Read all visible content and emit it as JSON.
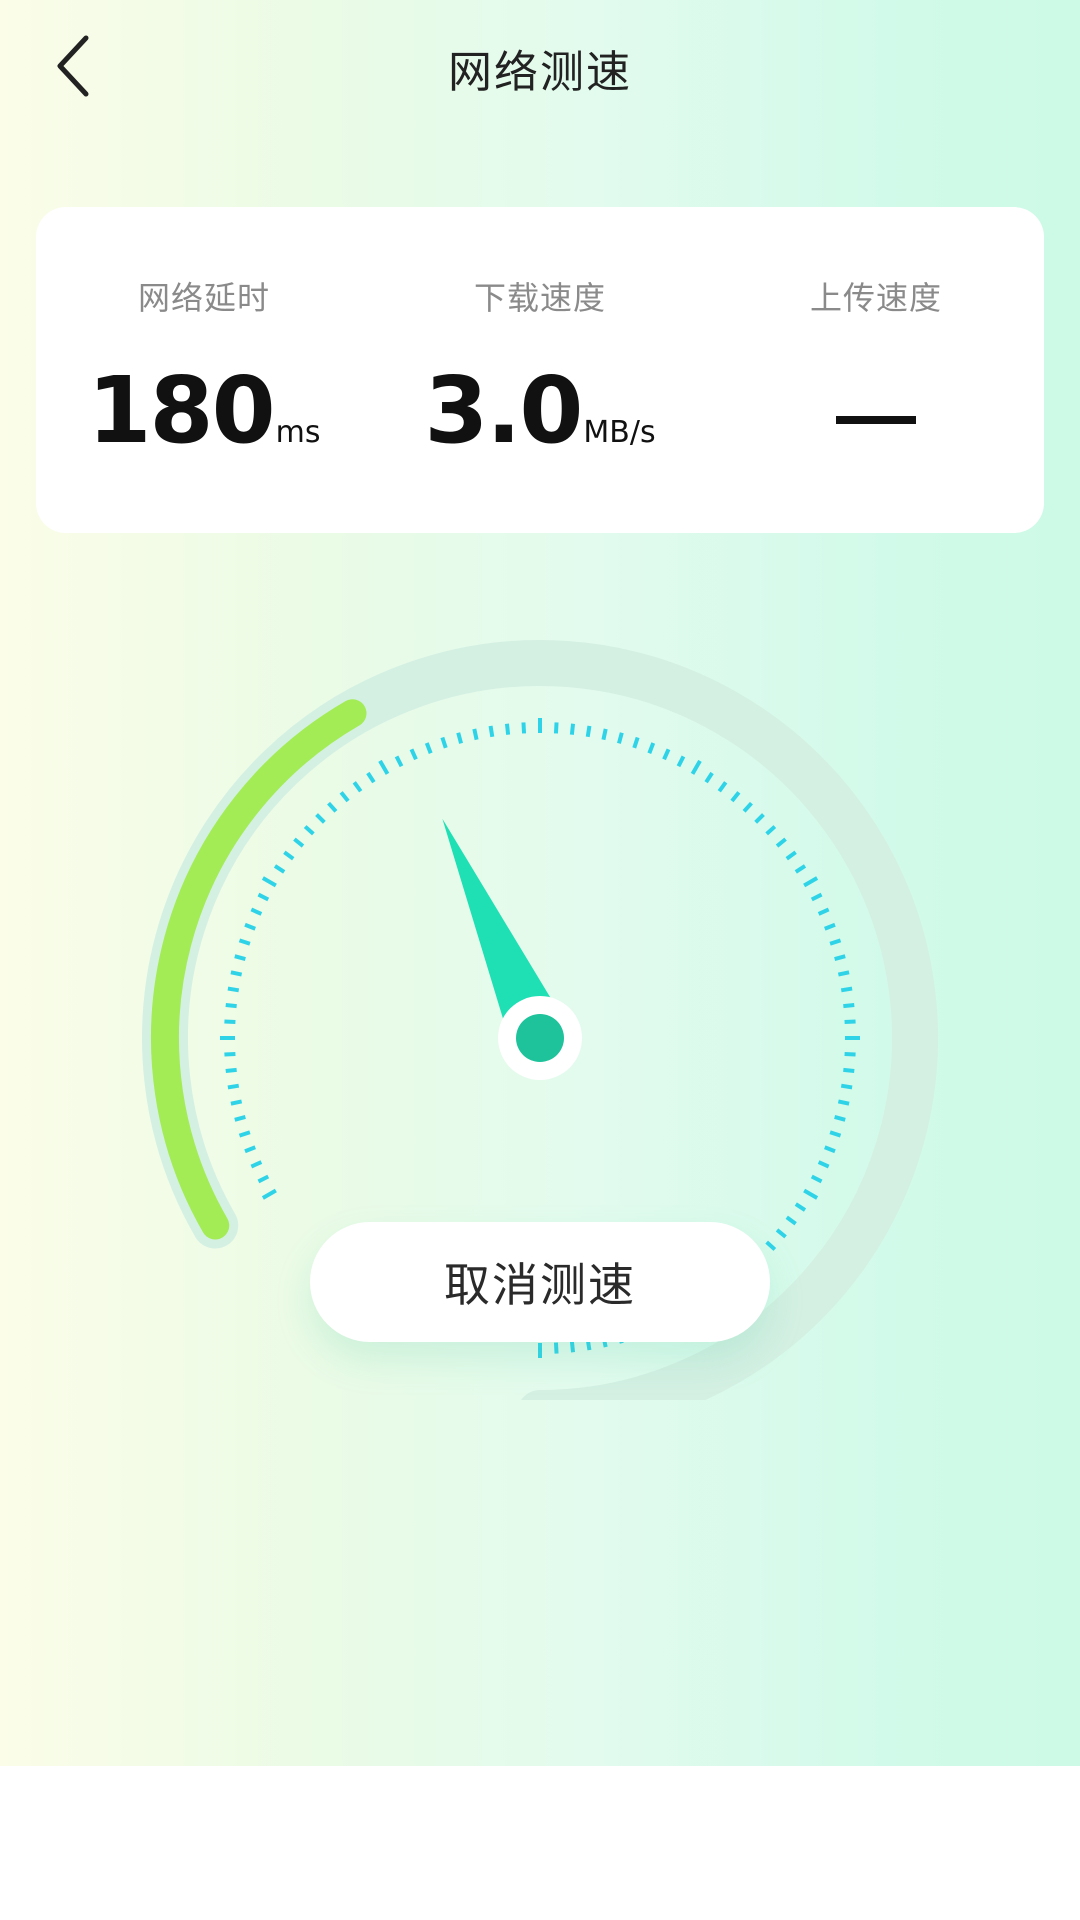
{
  "header": {
    "title": "网络测速",
    "back_icon": "chevron-left-icon"
  },
  "stats": {
    "latency": {
      "label": "网络延时",
      "value": "180",
      "unit": "ms"
    },
    "download": {
      "label": "下载速度",
      "value": "3.0",
      "unit": "MB/s"
    },
    "upload": {
      "label": "上传速度",
      "value": "—"
    }
  },
  "gauge": {
    "progress_fraction": 0.3,
    "needle_fraction": 0.32,
    "colors": {
      "track": "#d4f0e3",
      "progress": "#a3ec56",
      "ticks": "#2fd3e8",
      "needle": "#1ee0b4",
      "hub": "#1ec39b"
    }
  },
  "actions": {
    "cancel_label": "取消测速"
  }
}
